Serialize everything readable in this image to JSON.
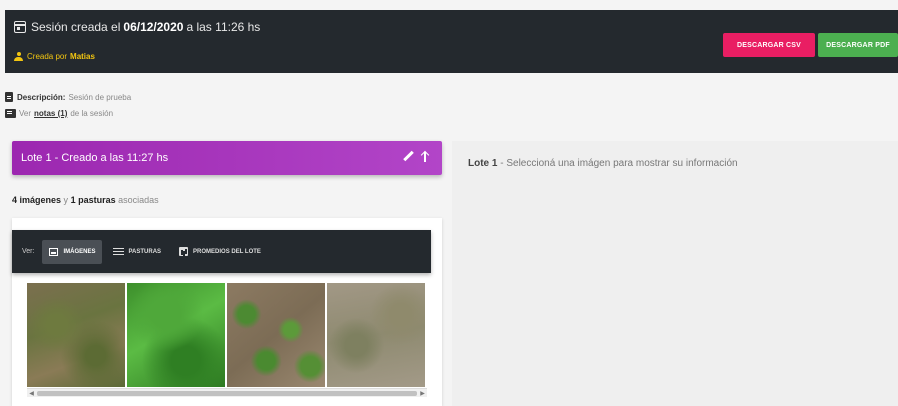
{
  "header": {
    "session_prefix": "Sesión creada el",
    "session_date": "06/12/2020",
    "session_mid": "a las",
    "session_time": "11:26 hs",
    "created_by_label": "Creada por",
    "created_by_name": "Matias",
    "csv_button": "DESCARGAR CSV",
    "pdf_button": "DESCARGAR PDF"
  },
  "description": {
    "label": "Descripción:",
    "value": "Sesión de prueba"
  },
  "notes": {
    "prefix": "Ver",
    "link": "notas (1)",
    "suffix": "de la sesión"
  },
  "lote": {
    "title": "Lote 1 - Creado a las 11:27 hs",
    "summary_images": "4 imágenes",
    "summary_and": "y",
    "summary_pastures": "1 pasturas",
    "summary_suffix": "asociadas"
  },
  "gallery_toolbar": {
    "ver_label": "Ver:",
    "tab_images": "IMÁGENES",
    "tab_pastures": "PASTURAS",
    "tab_averages": "PROMEDIOS DEL LOTE",
    "active_tab": "IMÁGENES"
  },
  "right_panel": {
    "lote_label": "Lote 1",
    "message": "- Seleccioná una imágen para mostrar su información"
  },
  "colors": {
    "header_bg": "#24292e",
    "csv_button": "#e91e63",
    "pdf_button": "#4caf50",
    "lote_bar": "#9c27b0",
    "creator_name": "#f2c511"
  }
}
